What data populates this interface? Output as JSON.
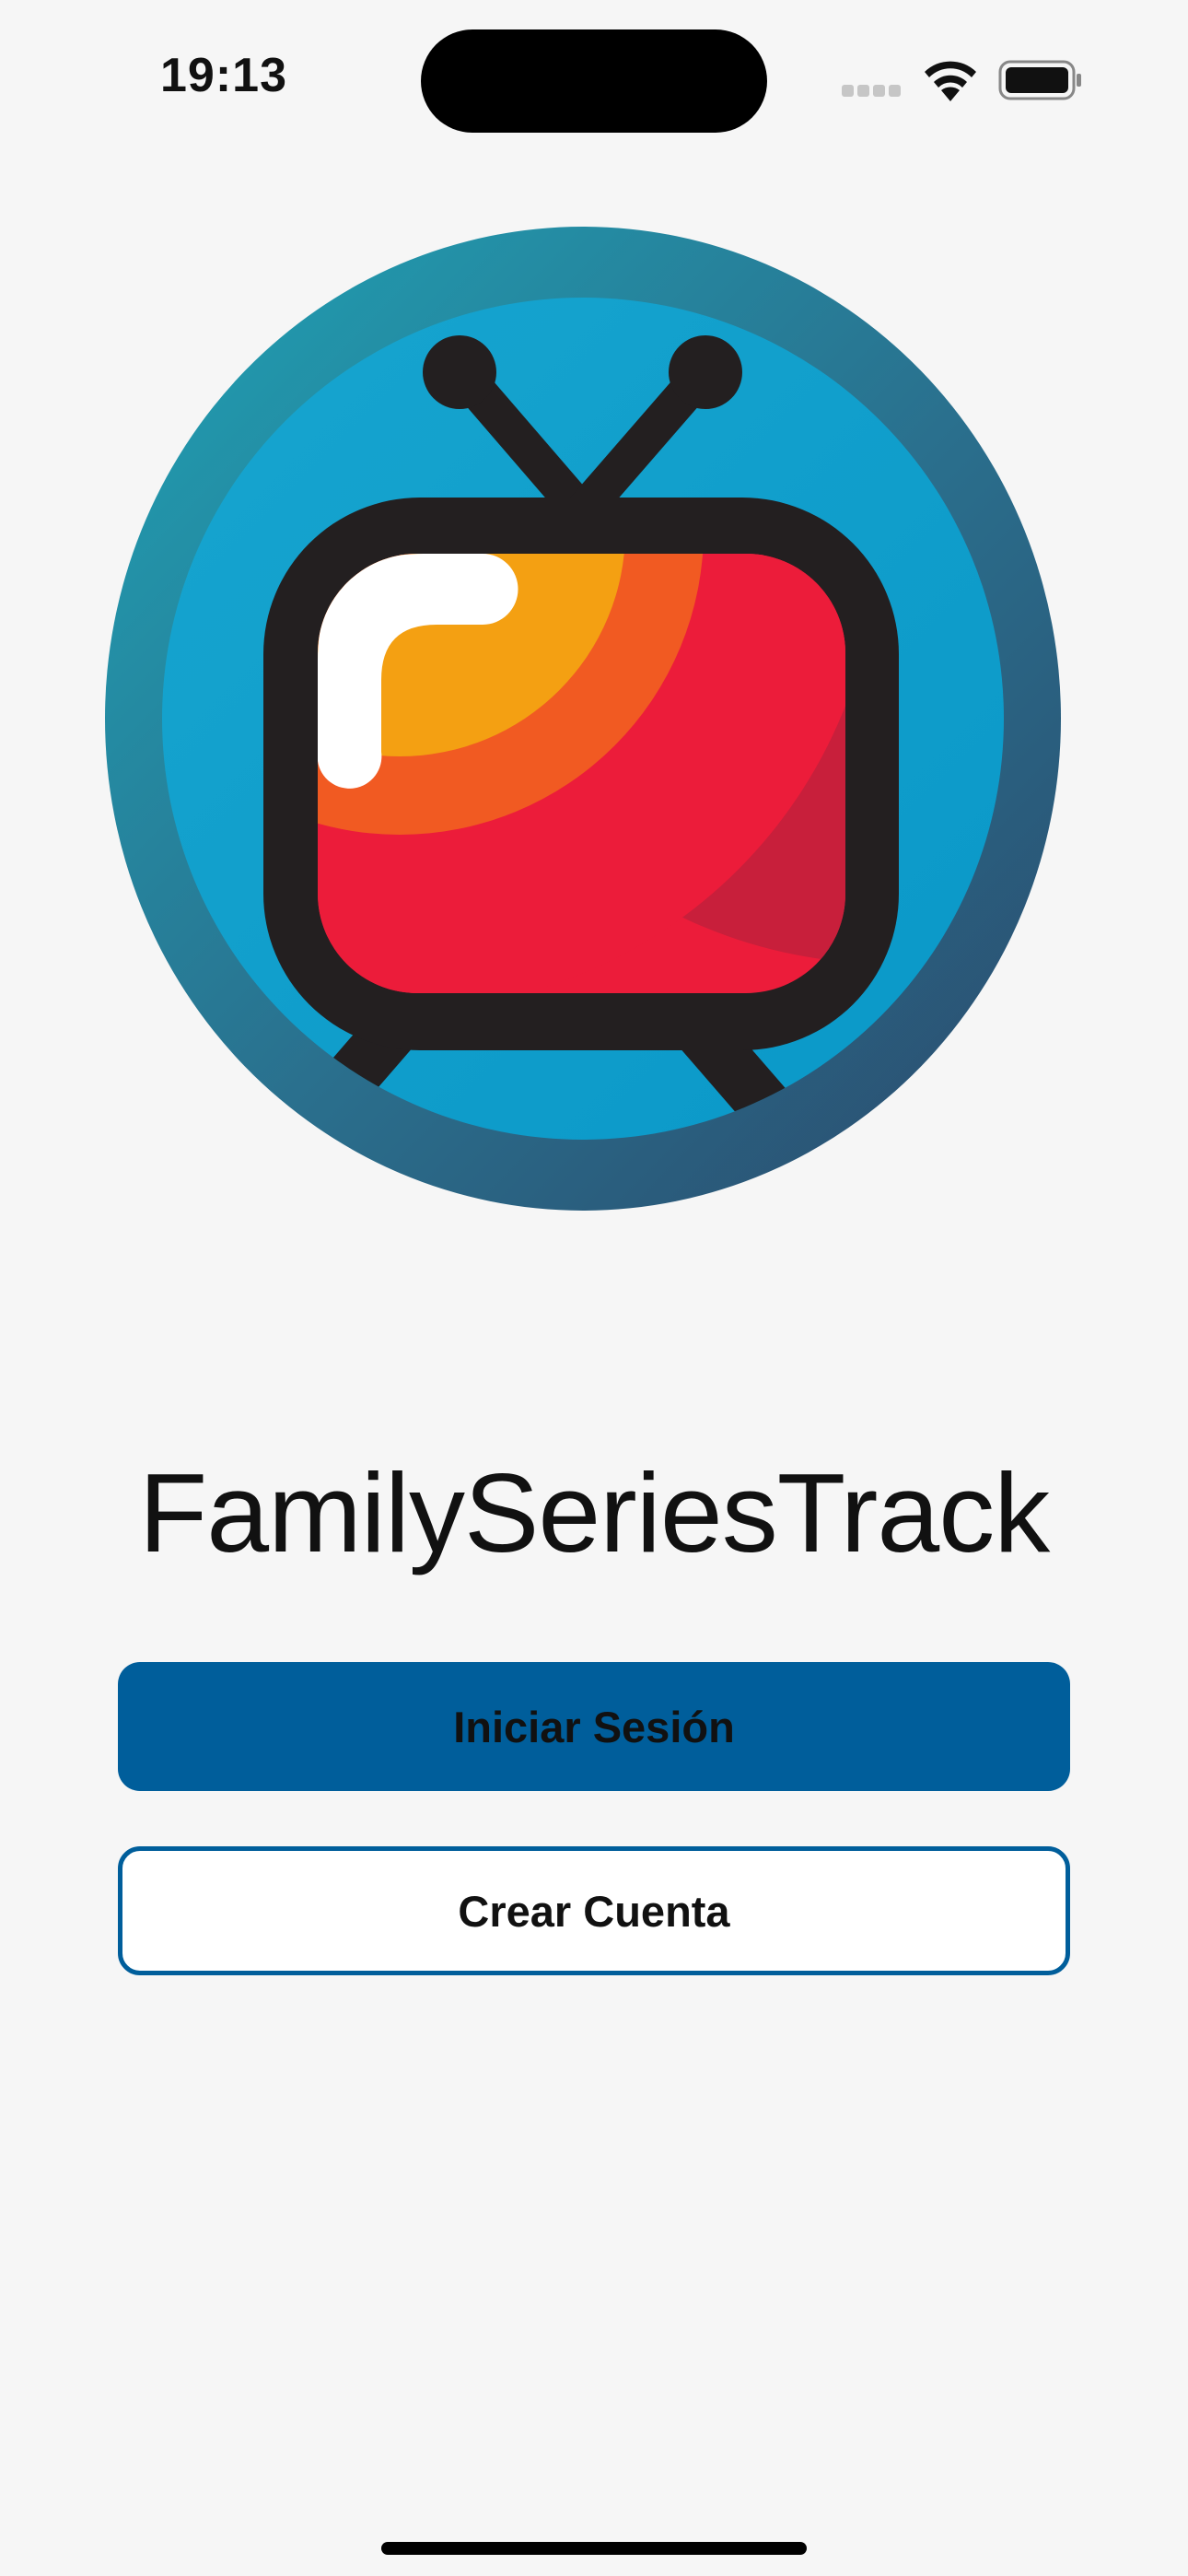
{
  "status_bar": {
    "time": "19:13",
    "icons": [
      "cellular-signal-icon",
      "wifi-icon",
      "battery-icon"
    ]
  },
  "logo": {
    "icon": "retro-tv-logo-icon",
    "colors": {
      "ring": "#2a5a7c",
      "background": "#129fcd",
      "frame": "#231f20",
      "screen_red": "#ec1c3a",
      "screen_orange": "#f15a22",
      "screen_yellow": "#f4a012",
      "highlight": "#ffffff"
    }
  },
  "title": "FamilySeriesTrack",
  "buttons": {
    "login_label": "Iniciar Sesión",
    "signup_label": "Crear Cuenta"
  },
  "colors": {
    "accent": "#005e9b",
    "background": "#f6f6f6"
  }
}
